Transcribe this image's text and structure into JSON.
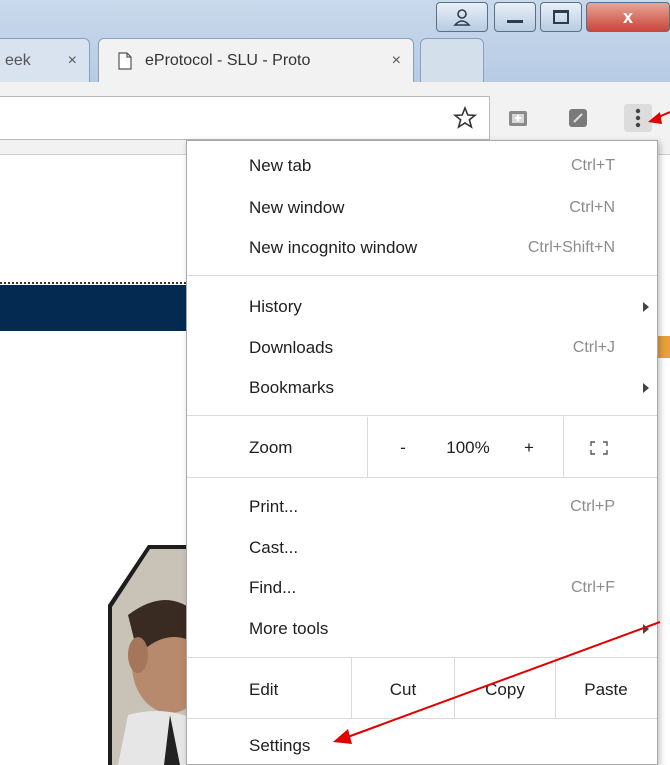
{
  "browser": {
    "tabs": [
      {
        "title": "eek"
      },
      {
        "title": "eProtocol - SLU - Proto"
      }
    ],
    "window_close_label": "x",
    "tab_close_label": "×"
  },
  "menu": {
    "section1": [
      {
        "label": "New tab",
        "shortcut": "Ctrl+T"
      },
      {
        "label": "New window",
        "shortcut": "Ctrl+N"
      },
      {
        "label": "New incognito window",
        "shortcut": "Ctrl+Shift+N"
      }
    ],
    "section2": [
      {
        "label": "History",
        "shortcut": ""
      },
      {
        "label": "Downloads",
        "shortcut": "Ctrl+J"
      },
      {
        "label": "Bookmarks",
        "shortcut": ""
      }
    ],
    "zoom": {
      "label": "Zoom",
      "minus": "-",
      "value": "100%",
      "plus": "+"
    },
    "section3": [
      {
        "label": "Print...",
        "shortcut": "Ctrl+P"
      },
      {
        "label": "Cast...",
        "shortcut": ""
      },
      {
        "label": "Find...",
        "shortcut": "Ctrl+F"
      },
      {
        "label": "More tools",
        "shortcut": ""
      }
    ],
    "edit": {
      "label": "Edit",
      "cut": "Cut",
      "copy": "Copy",
      "paste": "Paste"
    },
    "settings_label": "Settings"
  },
  "colors": {
    "annotation_arrow": "#e00000",
    "page_navbar": "#052a52",
    "titlebar": "#c9d9ec"
  }
}
